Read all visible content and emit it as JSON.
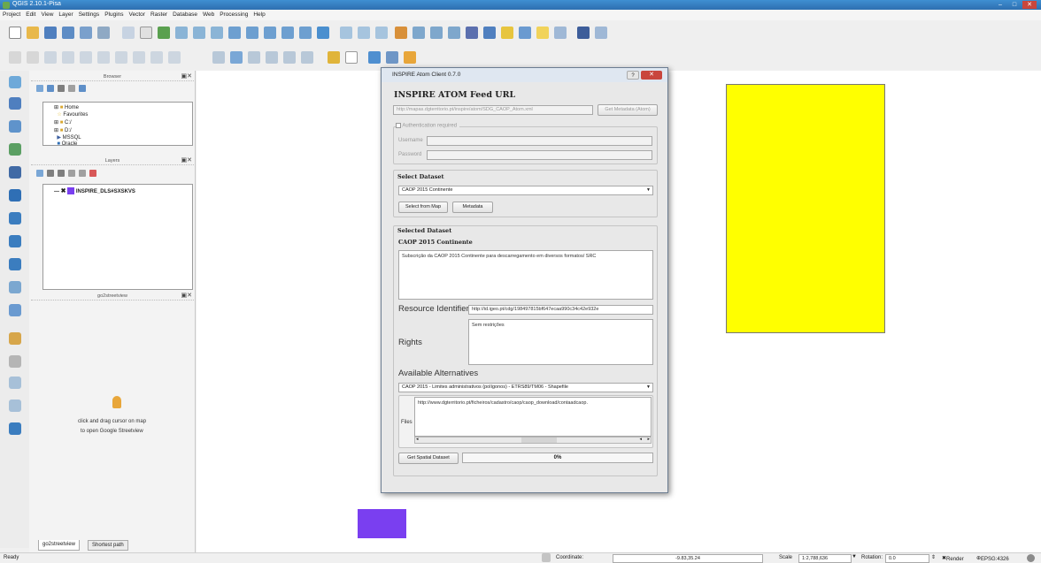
{
  "window": {
    "title": "QGIS 2.10.1-Pisa"
  },
  "menu": [
    "Project",
    "Edit",
    "View",
    "Layer",
    "Settings",
    "Plugins",
    "Vector",
    "Raster",
    "Database",
    "Web",
    "Processing",
    "Help"
  ],
  "dock": {
    "browser": {
      "title": "Browser",
      "items": [
        "Home",
        "Favourites",
        "C:/",
        "D:/",
        "MSSQL",
        "Oracle"
      ]
    },
    "layers": {
      "title": "Layers",
      "items": [
        "INSPIRE_DLS#SXSKVS"
      ]
    },
    "streetview": {
      "title": "go2streetview",
      "hint_line1": "click and drag cursor on map",
      "hint_line2": "to open Google Streetview"
    },
    "tabs": [
      "go2streetview",
      "Shortest path"
    ]
  },
  "dialog": {
    "title": "INSPIRE Atom Client 0.7.0",
    "heading": "INSPIRE ATOM Feed URL",
    "feed_url": "http://mapas.dgterritorio.pt/inspire/atom/SDG_CAOP_Atom.xml",
    "get_metadata_label": "Get Metadata (Atom)",
    "auth_label": "Authentication required",
    "username_label": "Username",
    "password_label": "Password",
    "select_dataset": {
      "heading": "Select Dataset",
      "selected": "CAOP 2015 Continente",
      "select_from_map": "Select from Map",
      "metadata": "Metadata"
    },
    "selected_dataset": {
      "heading": "Selected Dataset",
      "name": "CAOP 2015 Continente",
      "description": "Subscrição da CAOP 2015 Continente para descarregamento em diversos formatos/ SRC",
      "resource_identifier_label": "Resource Identifier",
      "resource_identifier": "http://id.igeo.pt/cdg/198497815bf647ecaa990c34c42e932e",
      "rights_label": "Rights",
      "rights": "Sem restrições",
      "alternatives_label": "Available Alternatives",
      "alternative": "CAOP 2015 - Limites administrativos (polígonos) - ETRS89/TM06 - Shapefile",
      "files_label": "Files",
      "file": "http://www.dgterritorio.pt/ficheiros/cadastro/caop/caop_download/contaadcaop.",
      "get_spatial_dataset": "Get Spatial Dataset",
      "progress_text": "0%",
      "progress": 0
    }
  },
  "map": {
    "yellow_color": "#ffff00",
    "purple_color": "#7a3ff0"
  },
  "statusbar": {
    "ready": "Ready",
    "coordinate_label": "Coordinate:",
    "coordinate": "-9.83,35.24",
    "scale_label": "Scale",
    "scale": "1:2,788,636",
    "rotation_label": "Rotation:",
    "rotation": "0.0",
    "render_label": "Render",
    "crs": "EPSG:4326"
  }
}
